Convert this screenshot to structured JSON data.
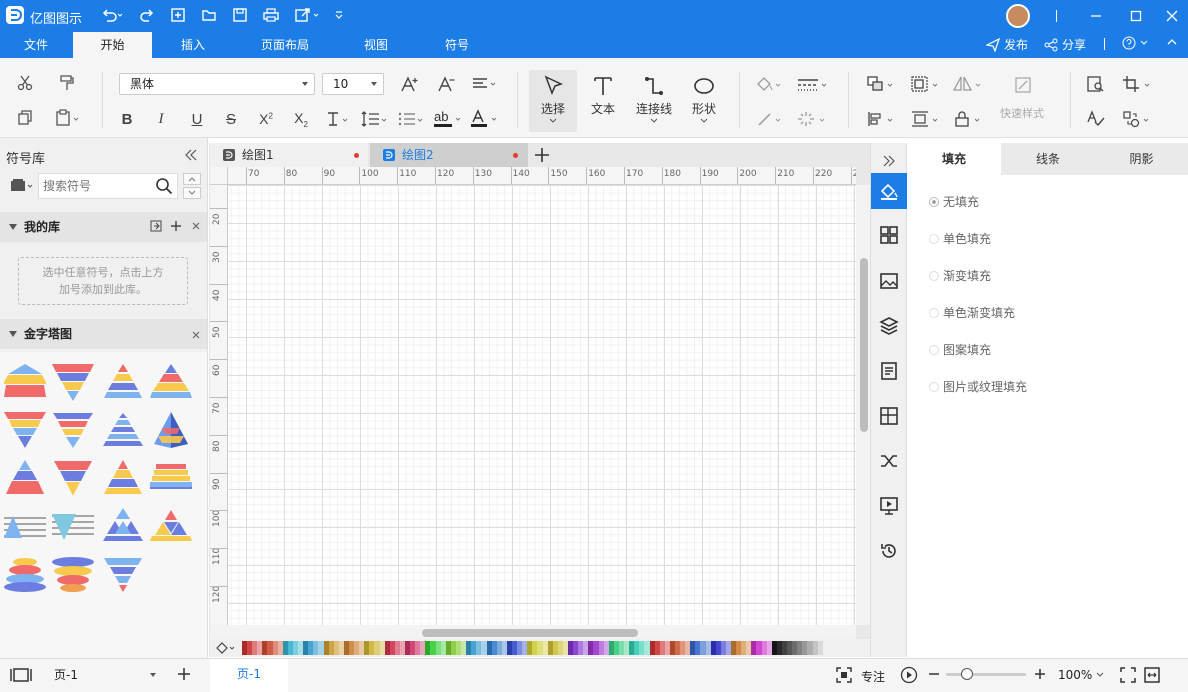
{
  "app": {
    "name": "亿图图示",
    "avatar_color": "#c88a5e"
  },
  "menu": {
    "tabs": [
      "文件",
      "开始",
      "插入",
      "页面布局",
      "视图",
      "符号"
    ],
    "active_index": 1
  },
  "header_right": {
    "publish": "发布",
    "share": "分享"
  },
  "ribbon": {
    "font_family": "黑体",
    "font_size": "10",
    "tools": {
      "select": "选择",
      "text": "文本",
      "connector": "连接线",
      "shape": "形状"
    },
    "quick_style": "快速样式"
  },
  "left_panel": {
    "title": "符号库",
    "search_placeholder": "搜索符号",
    "my_library": {
      "title": "我的库",
      "empty_hint_line1": "选中任意符号，点击上方",
      "empty_hint_line2": "加号添加到此库。"
    },
    "pyramid": {
      "title": "金字塔图"
    }
  },
  "documents": {
    "tabs": [
      "绘图1",
      "绘图2"
    ],
    "active_index": 1
  },
  "ruler": {
    "h_ticks": [
      "70",
      "80",
      "90",
      "100",
      "110",
      "120",
      "130",
      "140",
      "150",
      "160",
      "170",
      "180",
      "190",
      "200",
      "210",
      "220",
      "2"
    ],
    "v_ticks": [
      "20",
      "30",
      "40",
      "50",
      "60",
      "70",
      "80",
      "90",
      "100",
      "110",
      "120"
    ]
  },
  "properties": {
    "tabs": [
      "填充",
      "线条",
      "阴影"
    ],
    "active_tab": 0,
    "fill_options": [
      "无填充",
      "单色填充",
      "渐变填充",
      "单色渐变填充",
      "图案填充",
      "图片或纹理填充"
    ],
    "selected_option": 0
  },
  "statusbar": {
    "page_select": "页-1",
    "page_tab": "页-1",
    "focus": "专注",
    "zoom": "100%"
  },
  "colors": {
    "accent": "#1d7de6",
    "marker_red": "#e53935"
  }
}
